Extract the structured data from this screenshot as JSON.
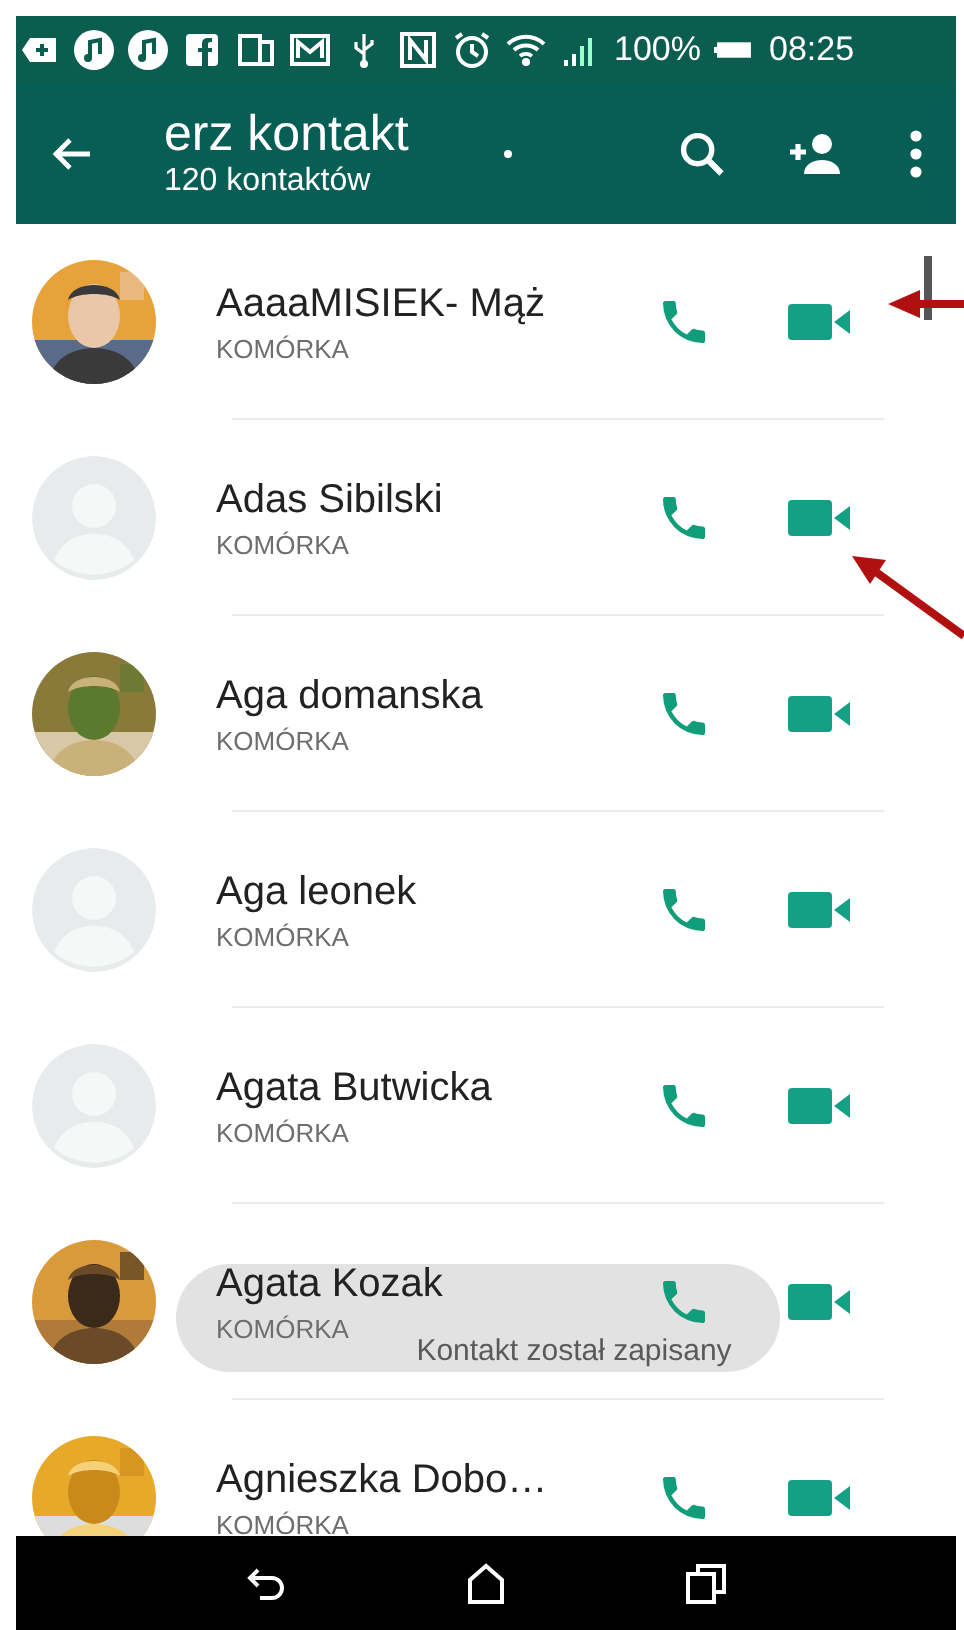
{
  "status_bar": {
    "battery": "100%",
    "time": "08:25"
  },
  "toolbar": {
    "title": "erz kontakt",
    "subtitle": "120 kontaktów"
  },
  "contacts": [
    {
      "name": "AaaaMISIEK- Mąż",
      "type": "KOMÓRKA"
    },
    {
      "name": "Adas Sibilski",
      "type": "KOMÓRKA",
      "kind": "placeholder"
    },
    {
      "name": "Aga domanska",
      "type": "KOMÓRKA"
    },
    {
      "name": "Aga leonek",
      "type": "KOMÓRKA",
      "kind": "placeholder"
    },
    {
      "name": "Agata Butwicka",
      "type": "KOMÓRKA",
      "kind": "placeholder"
    },
    {
      "name": "Agata Kozak",
      "type": "KOMÓRKA"
    },
    {
      "name": "Agnieszka Dobo…",
      "type": "KOMÓRKA"
    }
  ],
  "toast": {
    "text": "Kontakt został zapisany"
  }
}
